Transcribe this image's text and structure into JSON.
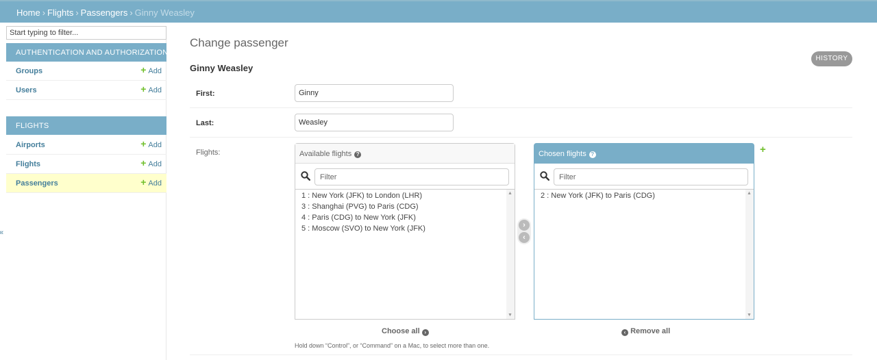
{
  "breadcrumbs": {
    "home": "Home",
    "sep": "›",
    "app": "Flights",
    "model": "Passengers",
    "current": "Ginny Weasley"
  },
  "sidebar": {
    "filter_placeholder": "Start typing to filter...",
    "modules": [
      {
        "title": "AUTHENTICATION AND AUTHORIZATION",
        "items": [
          {
            "label": "Groups",
            "add": "Add"
          },
          {
            "label": "Users",
            "add": "Add"
          }
        ]
      },
      {
        "title": "FLIGHTS",
        "items": [
          {
            "label": "Airports",
            "add": "Add"
          },
          {
            "label": "Flights",
            "add": "Add"
          },
          {
            "label": "Passengers",
            "add": "Add",
            "selected": true
          }
        ]
      }
    ],
    "collapse_icon": "«"
  },
  "page": {
    "title": "Change passenger",
    "object": "Ginny Weasley",
    "history": "HISTORY"
  },
  "form": {
    "first": {
      "label": "First:",
      "value": "Ginny"
    },
    "last": {
      "label": "Last:",
      "value": "Weasley"
    },
    "flights": {
      "label": "Flights:",
      "available": {
        "title": "Available flights",
        "filter_placeholder": "Filter",
        "options": [
          "1 : New York (JFK) to London (LHR)",
          "3 : Shanghai (PVG) to Paris (CDG)",
          "4 : Paris (CDG) to New York (JFK)",
          "5 : Moscow (SVO) to New York (JFK)"
        ],
        "choose_all": "Choose all"
      },
      "chosen": {
        "title": "Chosen flights",
        "filter_placeholder": "Filter",
        "options": [
          "2 : New York (JFK) to Paris (CDG)"
        ],
        "remove_all": "Remove all"
      },
      "help": "Hold down “Control”, or “Command” on a Mac, to select more than one."
    }
  },
  "icons": {
    "help": "question-circle-icon",
    "search": "search-icon",
    "add": "plus-icon",
    "move_right": "arrow-right-circle-icon",
    "move_left": "arrow-left-circle-icon"
  },
  "colors": {
    "header": "#79aec8",
    "link": "#447e9b",
    "add_green": "#70bf2b",
    "selected_row": "#ffffcc"
  }
}
